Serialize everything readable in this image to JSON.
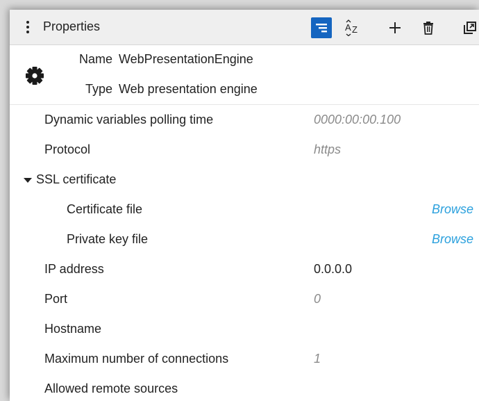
{
  "header": {
    "title": "Properties",
    "tools": [
      {
        "name": "categorized-view-icon",
        "active": true
      },
      {
        "name": "sort-az-icon",
        "glyph": "AZ"
      },
      {
        "name": "add-icon"
      },
      {
        "name": "delete-icon"
      },
      {
        "name": "pop-out-icon"
      }
    ]
  },
  "info": {
    "name_label": "Name",
    "name_value": "WebPresentationEngine",
    "type_label": "Type",
    "type_value": "Web presentation engine",
    "icon": "gear-icon"
  },
  "properties": [
    {
      "label": "Dynamic variables polling time",
      "value": "0000:00:00.100",
      "style": "muted"
    },
    {
      "label": "Protocol",
      "value": "https",
      "style": "muted"
    },
    {
      "label": "SSL certificate",
      "value": "",
      "style": "group",
      "expanded": true
    },
    {
      "label": "Certificate file",
      "value": "Browse",
      "style": "link",
      "indent": 1
    },
    {
      "label": "Private key file",
      "value": "Browse",
      "style": "link",
      "indent": 1
    },
    {
      "label": "IP address",
      "value": "0.0.0.0",
      "style": "normal"
    },
    {
      "label": "Port",
      "value": "0",
      "style": "muted"
    },
    {
      "label": "Hostname",
      "value": "",
      "style": "muted"
    },
    {
      "label": "Maximum number of connections",
      "value": "1",
      "style": "muted"
    },
    {
      "label": "Allowed remote sources",
      "value": "",
      "style": "muted"
    }
  ]
}
